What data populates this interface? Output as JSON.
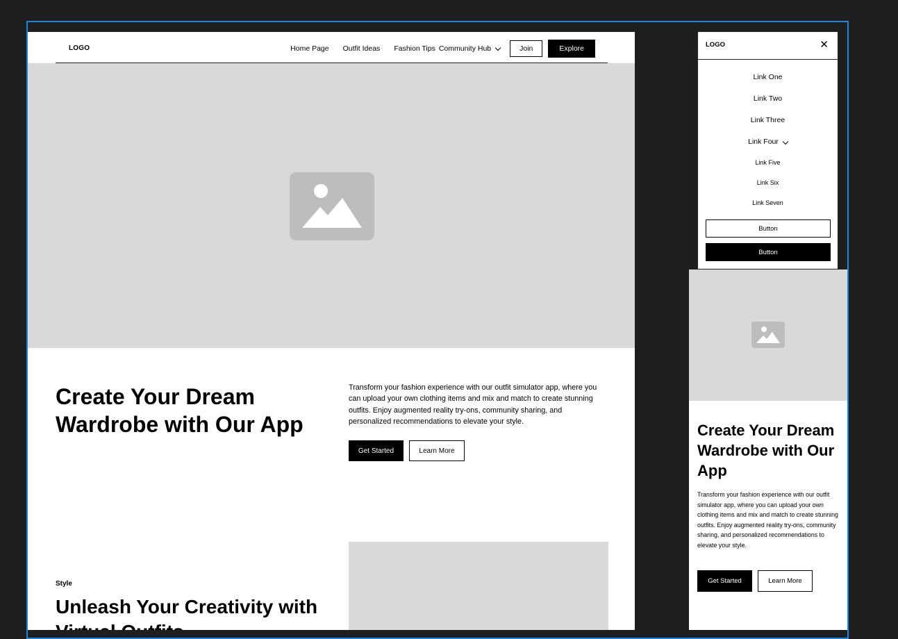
{
  "desktop": {
    "nav": {
      "logo": "LOGO",
      "links": [
        "Home Page",
        "Outfit Ideas",
        "Fashion Tips",
        "Community Hub"
      ],
      "join_label": "Join",
      "explore_label": "Explore"
    },
    "hero": {
      "image_icon": "image-placeholder-icon",
      "title": "Create Your Dream Wardrobe with Our App",
      "description": "Transform your fashion experience with our outfit simulator app, where you can upload your own clothing items and mix and match to create stunning outfits. Enjoy augmented reality try-ons, community sharing, and personalized recommendations to elevate your style.",
      "primary_label": "Get Started",
      "secondary_label": "Learn More"
    },
    "section": {
      "tag": "Style",
      "title": "Unleash Your Creativity with Virtual Outfits"
    }
  },
  "mobile_menu": {
    "logo": "LOGO",
    "close_icon": "close-icon",
    "links": [
      "Link One",
      "Link Two",
      "Link Three",
      "Link Four"
    ],
    "sub_links": [
      "Link Five",
      "Link Six",
      "Link Seven"
    ],
    "button1_label": "Button",
    "button2_label": "Button"
  },
  "mobile": {
    "image_icon": "image-placeholder-icon",
    "title": "Create Your Dream Wardrobe with Our App",
    "description": "Transform your fashion experience with our outfit simulator app, where you can upload your own clothing items and mix and match to create stunning outfits. Enjoy augmented reality try-ons, community sharing, and personalized recommendations to elevate your style.",
    "primary_label": "Get Started",
    "secondary_label": "Learn More"
  },
  "colors": {
    "canvas": "#1f1f1f",
    "frame_border": "#1e88e5",
    "placeholder": "#d9d9d9",
    "placeholder_icon": "#bdbdbd"
  }
}
